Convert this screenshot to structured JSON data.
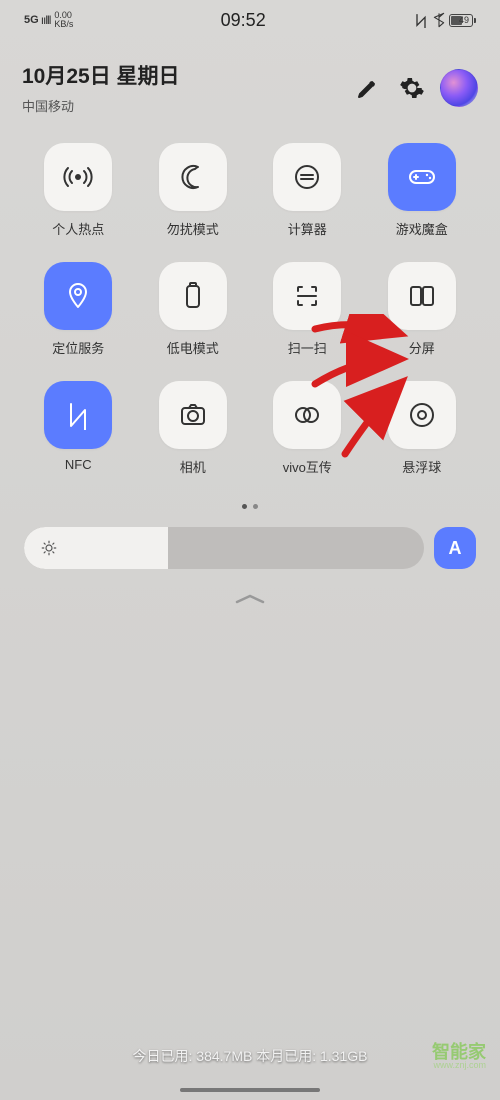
{
  "status": {
    "network": "5G",
    "speed_top": "0.00",
    "speed_bottom": "KB/s",
    "time": "09:52",
    "battery": "49"
  },
  "header": {
    "date": "10月25日 星期日",
    "carrier": "中国移动"
  },
  "tiles": [
    {
      "id": "hotspot",
      "label": "个人热点",
      "active": false,
      "icon": "hotspot"
    },
    {
      "id": "dnd",
      "label": "勿扰模式",
      "active": false,
      "icon": "moon"
    },
    {
      "id": "calculator",
      "label": "计算器",
      "active": false,
      "icon": "calc"
    },
    {
      "id": "gamebox",
      "label": "游戏魔盒",
      "active": true,
      "icon": "gamepad"
    },
    {
      "id": "location",
      "label": "定位服务",
      "active": true,
      "icon": "location"
    },
    {
      "id": "lowpower",
      "label": "低电模式",
      "active": false,
      "icon": "battery"
    },
    {
      "id": "scan",
      "label": "扫一扫",
      "active": false,
      "icon": "scan"
    },
    {
      "id": "split",
      "label": "分屏",
      "active": false,
      "icon": "split"
    },
    {
      "id": "nfc",
      "label": "NFC",
      "active": true,
      "icon": "nfc"
    },
    {
      "id": "camera",
      "label": "相机",
      "active": false,
      "icon": "camera"
    },
    {
      "id": "vivoshare",
      "label": "vivo互传",
      "active": false,
      "icon": "share"
    },
    {
      "id": "floatball",
      "label": "悬浮球",
      "active": false,
      "icon": "target"
    }
  ],
  "brightness": {
    "auto_label": "A"
  },
  "footer": {
    "data_usage": "今日已用: 384.7MB 本月已用: 1.31GB"
  },
  "watermark": {
    "name": "智能家",
    "domain": "www.znj.com"
  }
}
